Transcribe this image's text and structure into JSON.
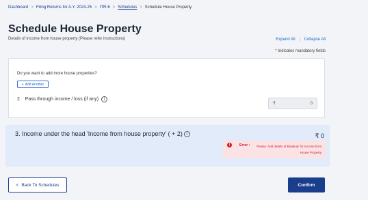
{
  "breadcrumb": {
    "items": [
      "Dashboard",
      "Filing Returns for A.Y. 2024-25",
      "ITR-6",
      "Schedules"
    ],
    "current": "Schedule House Property",
    "separator": ">"
  },
  "header": {
    "title": "Schedule House Property",
    "subtitle": "Details of income from house property (Please refer instructions)",
    "expand_all": "Expand All",
    "collapse_all": "Collapse All",
    "mandatory_note": "Indicates mandatory fields",
    "mandatory_star": "*"
  },
  "card": {
    "question": "Do you want to add more house properties?",
    "add_another": "Add Another",
    "add_icon": "+",
    "pass_through_label": "2.   Pass through income / loss (if any)",
    "currency_symbol": "₹",
    "pass_through_value": "0"
  },
  "income": {
    "title": "3. Income under the head 'Income from house property' ( + 2)",
    "amount": "₹ 0",
    "error_label": "Error :",
    "error_message": "Please 'Add details of Breakup' for Income from House Property"
  },
  "footer": {
    "back_label": "Back To Schedules",
    "back_icon": "<",
    "confirm_label": "Confirm"
  },
  "colors": {
    "primary": "#1a3e8c",
    "panel": "#e2ebfa",
    "error": "#d11a2a"
  }
}
